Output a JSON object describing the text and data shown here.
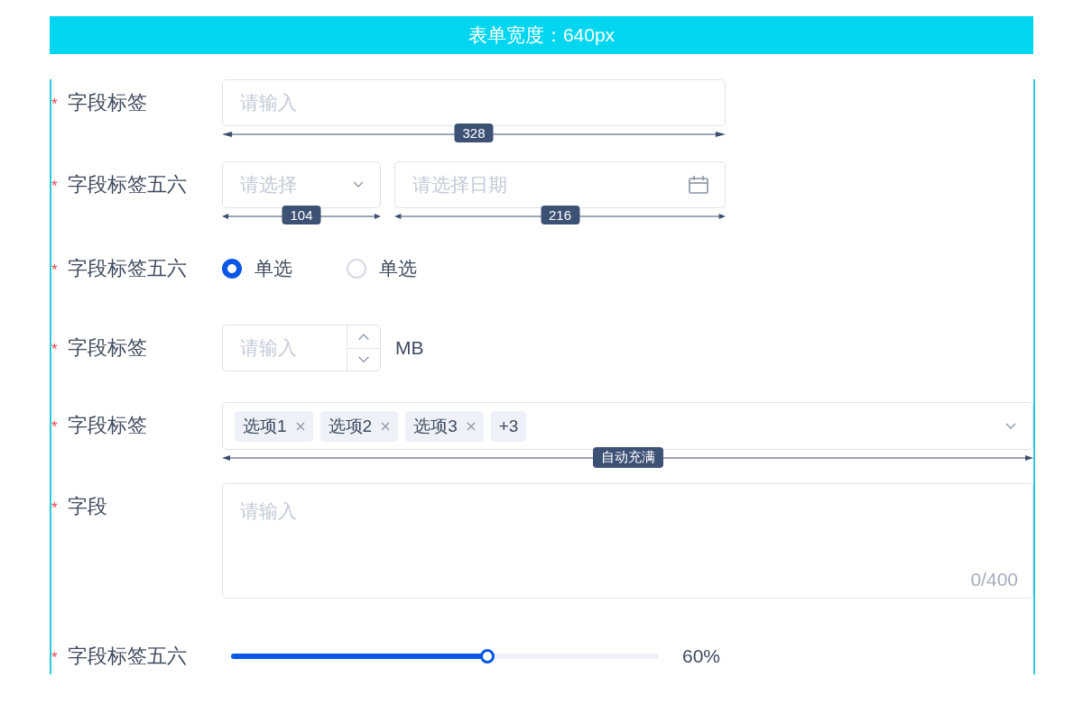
{
  "header": {
    "title": "表单宽度：640px"
  },
  "fields": [
    {
      "kind": "input",
      "mark": "*",
      "label": "字段标签",
      "placeholder": "请输入",
      "dimension": "328"
    },
    {
      "kind": "select-date",
      "mark": "*",
      "label": "字段标签五六",
      "select": {
        "placeholder": "请选择",
        "dimension": "104"
      },
      "date": {
        "placeholder": "请选择日期",
        "dimension": "216"
      }
    },
    {
      "kind": "radio",
      "mark": "*",
      "label": "字段标签五六",
      "options": [
        {
          "label": "单选",
          "selected": true
        },
        {
          "label": "单选",
          "selected": false
        }
      ]
    },
    {
      "kind": "number",
      "mark": "*",
      "label": "字段标签",
      "placeholder": "请输入",
      "unit": "MB"
    },
    {
      "kind": "tags",
      "mark": "*",
      "label": "字段标签",
      "tags": [
        {
          "label": "选项1",
          "removable": true
        },
        {
          "label": "选项2",
          "removable": true
        },
        {
          "label": "选项3",
          "removable": true
        },
        {
          "label": "+3",
          "removable": false
        }
      ],
      "dimension": "自动充满"
    },
    {
      "kind": "textarea",
      "mark": "*",
      "label": "字段",
      "placeholder": "请输入",
      "counter": "0/400"
    },
    {
      "kind": "slider",
      "mark": "*",
      "label": "字段标签五六",
      "level": 0.6,
      "reading": "60%"
    }
  ]
}
